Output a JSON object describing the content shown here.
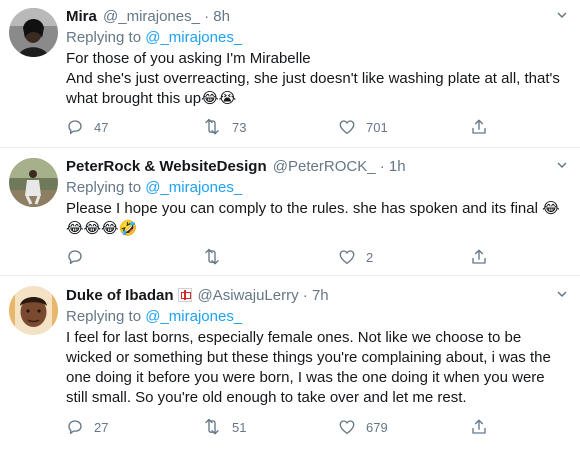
{
  "tweets": [
    {
      "name": "Mira",
      "handle": "@_mirajones_",
      "dot": "·",
      "time": "8h",
      "replying_prefix": "Replying to",
      "replying_to": "@_mirajones_",
      "body_lines": [
        "For those of you asking I'm Mirabelle",
        "And she's just overreacting, she just doesn't like washing plate at all,  that's what brought this up😂😭"
      ],
      "reply_count": "47",
      "retweet_count": "73",
      "like_count": "701"
    },
    {
      "name": "PeterRock & WebsiteDesign",
      "handle": "@PeterROCK_",
      "dot": "·",
      "time": "1h",
      "replying_prefix": "Replying to",
      "replying_to": "@_mirajones_",
      "body_lines": [
        "Please I hope you can comply to the rules.  she has spoken and its final 😂",
        "😂😂😂🤣"
      ],
      "reply_count": "",
      "retweet_count": "",
      "like_count": "2"
    },
    {
      "name": "Duke of Ibadan",
      "handle": "@AsiwajuLerry",
      "dot": "·",
      "time": "7h",
      "replying_prefix": "Replying to",
      "replying_to": "@_mirajones_",
      "body_lines": [
        "I feel for last borns, especially female ones. Not like we choose to be wicked or something but these things you're complaining about, i was the one doing it before you were born, I was the one doing it when you were still small. So you're old enough to take over and let me rest."
      ],
      "reply_count": "27",
      "retweet_count": "51",
      "like_count": "679"
    }
  ],
  "icons": {
    "reply": "reply-icon",
    "retweet": "retweet-icon",
    "like": "heart-icon",
    "share": "share-icon",
    "more": "chevron-down-icon",
    "badge": "mahjong-red-dragon-icon"
  },
  "colors": {
    "text": "#14171a",
    "secondary": "#657786",
    "link": "#1da1f2",
    "divider": "#e6ecf0"
  }
}
